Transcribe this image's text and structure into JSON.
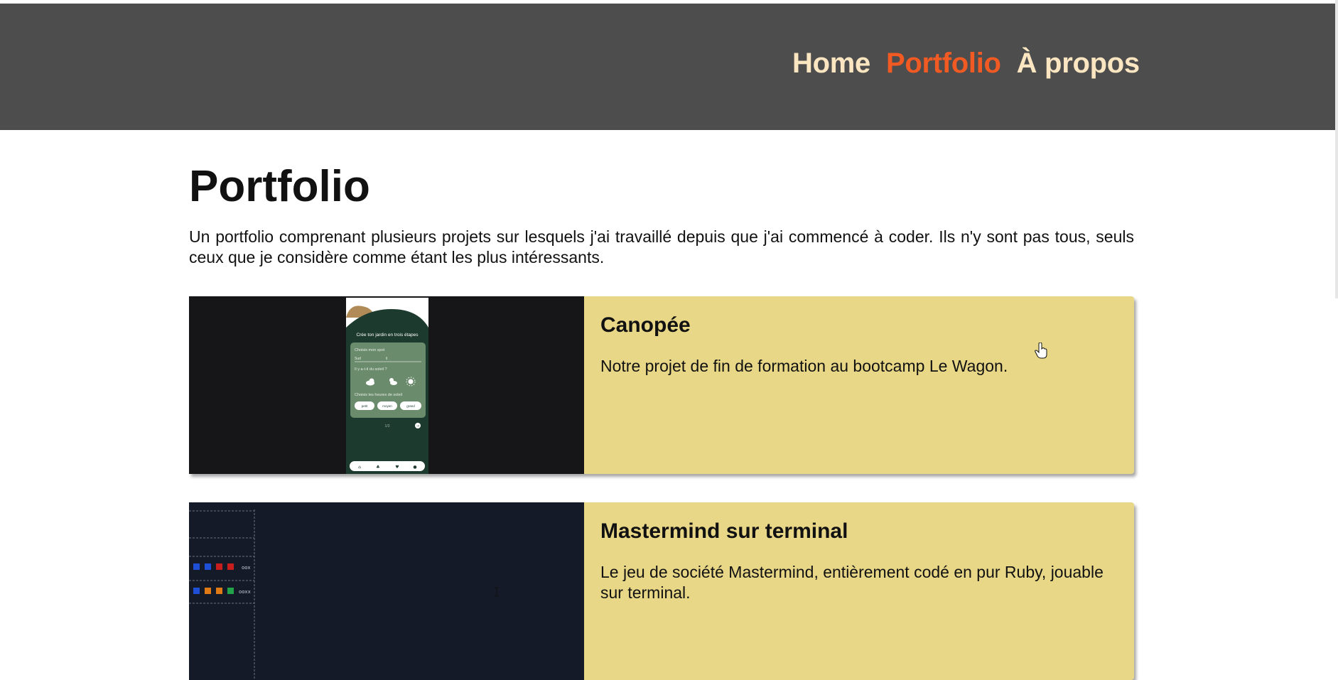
{
  "nav": {
    "items": [
      {
        "label": "Home",
        "active": false
      },
      {
        "label": "Portfolio",
        "active": true
      },
      {
        "label": "À propos",
        "active": false
      }
    ]
  },
  "page": {
    "title": "Portfolio",
    "intro": "Un portfolio comprenant plusieurs projets sur lesquels j'ai travaillé depuis que j'ai commencé à coder. Ils n'y sont pas tous, seuls ceux que je considère comme étant les plus intéressants."
  },
  "projects": [
    {
      "title": "Canopée",
      "description": "Notre projet de fin de formation au bootcamp Le Wagon.",
      "thumbnail": {
        "heading": "Crée ton jardin en trois étapes",
        "label_spot": "Choisis mon spot",
        "select_value": "Sud",
        "label_sun": "Il y a-t-il du soleil ?",
        "label_time": "Choisis tes heures de soleil",
        "buttons": [
          "petit",
          "moyen",
          "grand"
        ],
        "step": "1/3"
      }
    },
    {
      "title": "Mastermind sur terminal",
      "description": "Le jeu de société Mastermind, entièrement codé en pur Ruby, jouable sur terminal.",
      "thumbnail": {
        "row_label_1": "oox",
        "row_label_2": "ooxx"
      }
    }
  ],
  "colors": {
    "header_bg": "#4d4d4d",
    "nav_text": "#fbe6c1",
    "nav_active": "#f15a22",
    "card_bg": "#e8d787",
    "thumb_bg_dark": "#161618",
    "thumb_bg_navy": "#141a28",
    "app_green": "#1d3a2e"
  }
}
